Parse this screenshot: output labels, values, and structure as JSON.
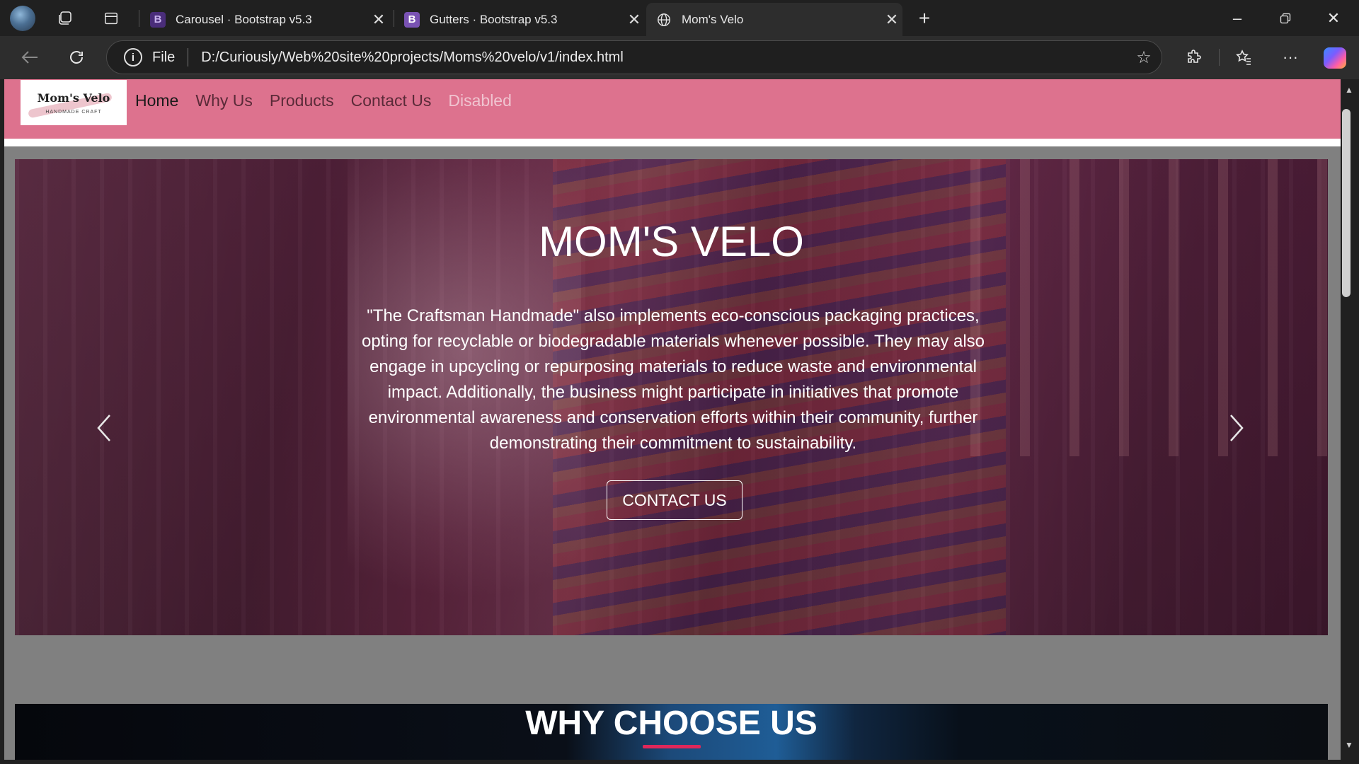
{
  "browser": {
    "tabs": [
      {
        "label": "Carousel · Bootstrap v5.3",
        "favicon": "B"
      },
      {
        "label": "Gutters · Bootstrap v5.3",
        "favicon": "B"
      },
      {
        "label": "Mom's Velo",
        "favicon": "globe"
      }
    ],
    "address": {
      "scheme_label": "File",
      "url": "D:/Curiously/Web%20site%20projects/Moms%20velo/v1/index.html"
    },
    "icons": [
      "profile-avatar",
      "workspaces-icon",
      "tab-actions-icon",
      "new-tab-icon",
      "minimize-icon",
      "restore-icon",
      "close-icon",
      "back-icon",
      "refresh-icon",
      "info-icon",
      "star-icon",
      "extensions-icon",
      "favorites-icon",
      "more-icon",
      "copilot-icon"
    ]
  },
  "site": {
    "logo": {
      "name": "Mom's Velo",
      "tagline": "HANDMADE CRAFT"
    },
    "nav": [
      {
        "label": "Home",
        "state": "active"
      },
      {
        "label": "Why Us",
        "state": "normal"
      },
      {
        "label": "Products",
        "state": "normal"
      },
      {
        "label": "Contact Us",
        "state": "normal"
      },
      {
        "label": "Disabled",
        "state": "disabled"
      }
    ],
    "hero": {
      "title": "MOM'S VELO",
      "text": "\"The Craftsman Handmade\" also implements eco-conscious packaging practices, opting for recyclable or biodegradable materials whenever possible. They may also engage in upcycling or repurposing materials to reduce waste and environmental impact. Additionally, the business might participate in initiatives that promote environmental awareness and conservation efforts within their community, further demonstrating their commitment to sustainability.",
      "button": "CONTACT US"
    },
    "why": {
      "title": "WHY CHOOSE US"
    }
  },
  "colors": {
    "navbar": "#dd728e",
    "accent_underline": "#e0275a",
    "page_background": "#808080"
  }
}
